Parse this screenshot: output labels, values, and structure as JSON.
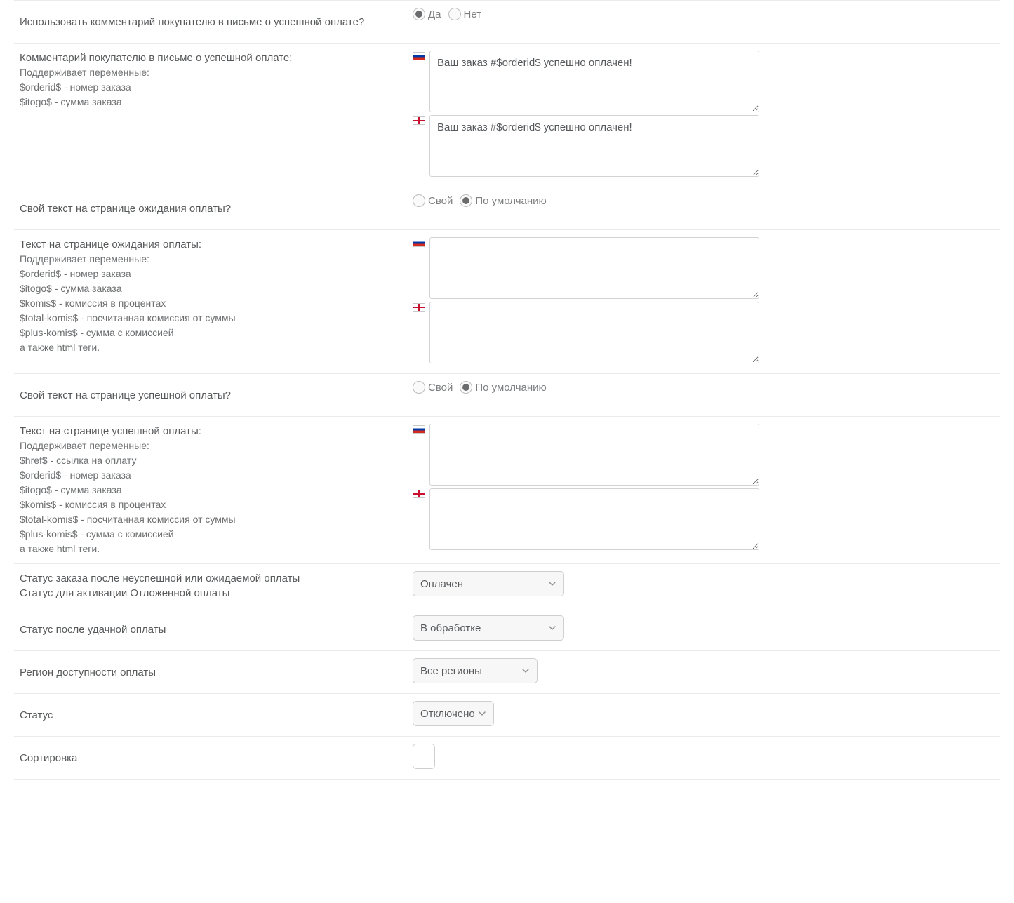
{
  "rows": {
    "useComment": {
      "label": "Использовать комментарий покупателю в письме о успешной оплате?",
      "yes": "Да",
      "no": "Нет"
    },
    "commentText": {
      "label": "Комментарий покупателю в письме о успешной оплате:",
      "sub1": "Поддерживает переменные:",
      "sub2": "$orderid$ - номер заказа",
      "sub3": "$itogo$ - сумма заказа",
      "ru_value": "Ваш заказ #$orderid$ успешно оплачен!",
      "en_value": "Ваш заказ #$orderid$ успешно оплачен!"
    },
    "ownWaitText": {
      "label": "Свой текст на странице ожидания оплаты?",
      "own": "Свой",
      "default": "По умолчанию"
    },
    "waitText": {
      "label": "Текст на странице ожидания оплаты:",
      "sub1": "Поддерживает переменные:",
      "sub2": "$orderid$ - номер заказа",
      "sub3": "$itogo$ - сумма заказа",
      "sub4": "$komis$ - комиссия в процентах",
      "sub5": "$total-komis$ - посчитанная комиссия от суммы",
      "sub6": "$plus-komis$ - сумма с комиссией",
      "sub7": "а также html теги.",
      "ru_value": "",
      "en_value": ""
    },
    "ownSuccessText": {
      "label": "Свой текст на странице успешной оплаты?",
      "own": "Свой",
      "default": "По умолчанию"
    },
    "successText": {
      "label": "Текст на странице успешной оплаты:",
      "sub1": "Поддерживает переменные:",
      "sub2": "$href$ - ссылка на оплату",
      "sub3": "$orderid$ - номер заказа",
      "sub4": "$itogo$ - сумма заказа",
      "sub5": "$komis$ - комиссия в процентах",
      "sub6": "$total-komis$ - посчитанная комиссия от суммы",
      "sub7": "$plus-komis$ - сумма с комиссией",
      "sub8": "а также html теги.",
      "ru_value": "",
      "en_value": ""
    },
    "statusFail": {
      "label1": "Статус заказа после неуспешной или ожидаемой оплаты",
      "label2": "Статус для активации Отложенной оплаты",
      "value": "Оплачен"
    },
    "statusSuccess": {
      "label": "Статус после удачной оплаты",
      "value": "В обработке"
    },
    "region": {
      "label": "Регион доступности оплаты",
      "value": "Все регионы"
    },
    "status": {
      "label": "Статус",
      "value": "Отключено"
    },
    "sort": {
      "label": "Сортировка",
      "value": ""
    }
  }
}
